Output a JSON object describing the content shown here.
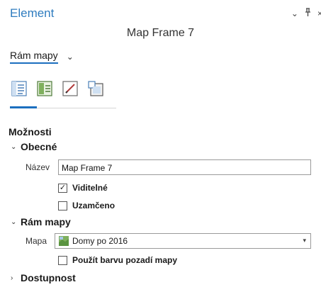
{
  "pane": {
    "title": "Element",
    "element_name": "Map Frame 7",
    "header_icons": {
      "collapse": "⌄",
      "pin": "ᵖ",
      "close": "×"
    }
  },
  "element_type": {
    "selected": "Rám mapy"
  },
  "tabs": [
    {
      "icon": "options-icon",
      "selected": true
    },
    {
      "icon": "display-icon",
      "selected": false
    },
    {
      "icon": "pencil-icon",
      "selected": false
    },
    {
      "icon": "placement-icon",
      "selected": false
    }
  ],
  "options": {
    "section_title": "Možnosti",
    "general": {
      "header": "Obecné",
      "name_label": "Název",
      "name_value": "Map Frame 7",
      "visible_label": "Viditelné",
      "visible_checked": true,
      "locked_label": "Uzamčeno",
      "locked_checked": false
    },
    "map_frame": {
      "header": "Rám mapy",
      "map_label": "Mapa",
      "map_value": "Domy po 2016",
      "bg_label": "Použít barvu pozadí mapy",
      "bg_checked": false
    },
    "accessibility": {
      "header": "Dostupnost"
    }
  },
  "colors": {
    "accent": "#1c6fbf",
    "title": "#2f7cbf"
  }
}
